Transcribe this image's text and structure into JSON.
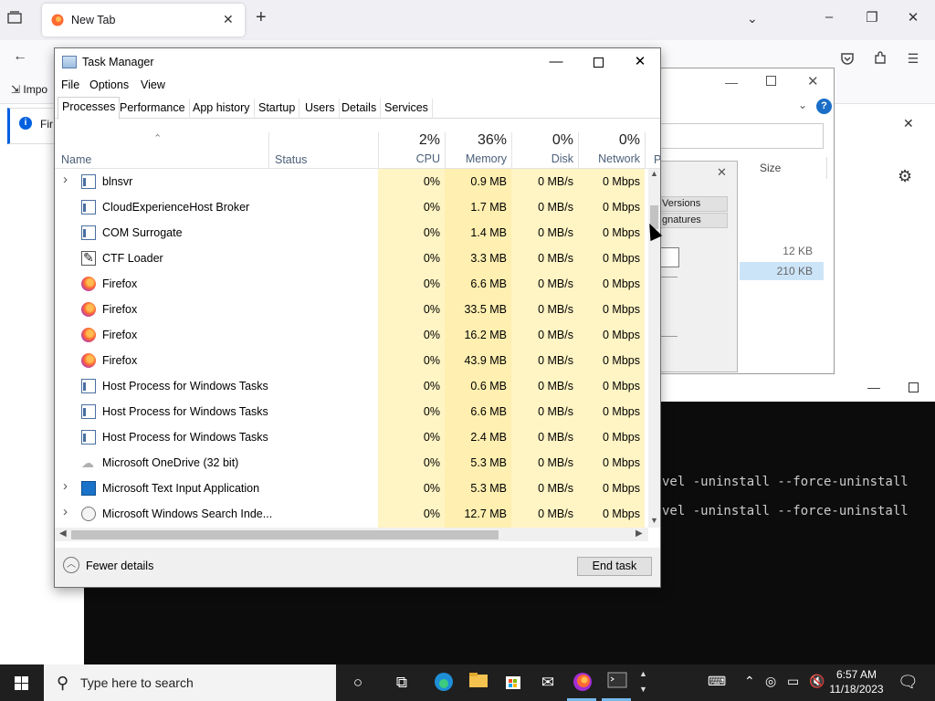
{
  "firefox": {
    "tab_label": "New Tab",
    "import_label": "Impo",
    "info_text": "Fir"
  },
  "file_dialog": {
    "help_label": "?",
    "tab_versions": "Versions",
    "tab_signatures": "gnatures",
    "size_header": "Size",
    "sizes": [
      "12 KB",
      "210 KB"
    ]
  },
  "terminal": {
    "lines": [
      "vel -uninstall --force-uninstall",
      "vel -uninstall --force-uninstall"
    ]
  },
  "task_manager": {
    "title": "Task Manager",
    "menu": [
      "File",
      "Options",
      "View"
    ],
    "tabs": [
      "Processes",
      "Performance",
      "App history",
      "Startup",
      "Users",
      "Details",
      "Services"
    ],
    "active_tab": "Processes",
    "columns": {
      "name": "Name",
      "status": "Status",
      "cpu": {
        "pct": "2%",
        "label": "CPU"
      },
      "memory": {
        "pct": "36%",
        "label": "Memory"
      },
      "disk": {
        "pct": "0%",
        "label": "Disk"
      },
      "network": {
        "pct": "0%",
        "label": "Network"
      },
      "power": "P"
    },
    "rows": [
      {
        "expand": true,
        "icon": "window-icon",
        "name": "blnsvr",
        "cpu": "0%",
        "memory": "0.9 MB",
        "disk": "0 MB/s",
        "network": "0 Mbps"
      },
      {
        "expand": false,
        "icon": "window-icon",
        "name": "CloudExperienceHost Broker",
        "cpu": "0%",
        "memory": "1.7 MB",
        "disk": "0 MB/s",
        "network": "0 Mbps"
      },
      {
        "expand": false,
        "icon": "window-icon",
        "name": "COM Surrogate",
        "cpu": "0%",
        "memory": "1.4 MB",
        "disk": "0 MB/s",
        "network": "0 Mbps"
      },
      {
        "expand": false,
        "icon": "ctf-icon",
        "name": "CTF Loader",
        "cpu": "0%",
        "memory": "3.3 MB",
        "disk": "0 MB/s",
        "network": "0 Mbps"
      },
      {
        "expand": false,
        "icon": "firefox-icon",
        "name": "Firefox",
        "cpu": "0%",
        "memory": "6.6 MB",
        "disk": "0 MB/s",
        "network": "0 Mbps"
      },
      {
        "expand": false,
        "icon": "firefox-icon",
        "name": "Firefox",
        "cpu": "0%",
        "memory": "33.5 MB",
        "disk": "0 MB/s",
        "network": "0 Mbps"
      },
      {
        "expand": false,
        "icon": "firefox-icon",
        "name": "Firefox",
        "cpu": "0%",
        "memory": "16.2 MB",
        "disk": "0 MB/s",
        "network": "0 Mbps"
      },
      {
        "expand": false,
        "icon": "firefox-icon",
        "name": "Firefox",
        "cpu": "0%",
        "memory": "43.9 MB",
        "disk": "0 MB/s",
        "network": "0 Mbps"
      },
      {
        "expand": false,
        "icon": "window-icon",
        "name": "Host Process for Windows Tasks",
        "cpu": "0%",
        "memory": "0.6 MB",
        "disk": "0 MB/s",
        "network": "0 Mbps"
      },
      {
        "expand": false,
        "icon": "window-icon",
        "name": "Host Process for Windows Tasks",
        "cpu": "0%",
        "memory": "6.6 MB",
        "disk": "0 MB/s",
        "network": "0 Mbps"
      },
      {
        "expand": false,
        "icon": "window-icon",
        "name": "Host Process for Windows Tasks",
        "cpu": "0%",
        "memory": "2.4 MB",
        "disk": "0 MB/s",
        "network": "0 Mbps"
      },
      {
        "expand": false,
        "icon": "cloud-icon",
        "name": "Microsoft OneDrive (32 bit)",
        "cpu": "0%",
        "memory": "5.3 MB",
        "disk": "0 MB/s",
        "network": "0 Mbps"
      },
      {
        "expand": true,
        "icon": "text-input-icon",
        "name": "Microsoft Text Input Application",
        "cpu": "0%",
        "memory": "5.3 MB",
        "disk": "0 MB/s",
        "network": "0 Mbps"
      },
      {
        "expand": true,
        "icon": "search-indexer-icon",
        "name": "Microsoft Windows Search Inde...",
        "cpu": "0%",
        "memory": "12.7 MB",
        "disk": "0 MB/s",
        "network": "0 Mbps"
      }
    ],
    "fewer_details": "Fewer details",
    "end_task": "End task",
    "colors": {
      "cpu_bg": "#fff4c4",
      "memory_bg": "#ffefb0",
      "disk_bg": "#fff4c4",
      "network_bg": "#fff4c4"
    }
  },
  "taskbar": {
    "search_placeholder": "Type here to search",
    "time": "6:57 AM",
    "date": "11/18/2023",
    "pinned_icons": [
      "cortana-icon",
      "task-view-icon",
      "edge-icon",
      "file-explorer-icon",
      "store-icon",
      "mail-icon",
      "firefox-icon",
      "terminal-icon"
    ]
  }
}
